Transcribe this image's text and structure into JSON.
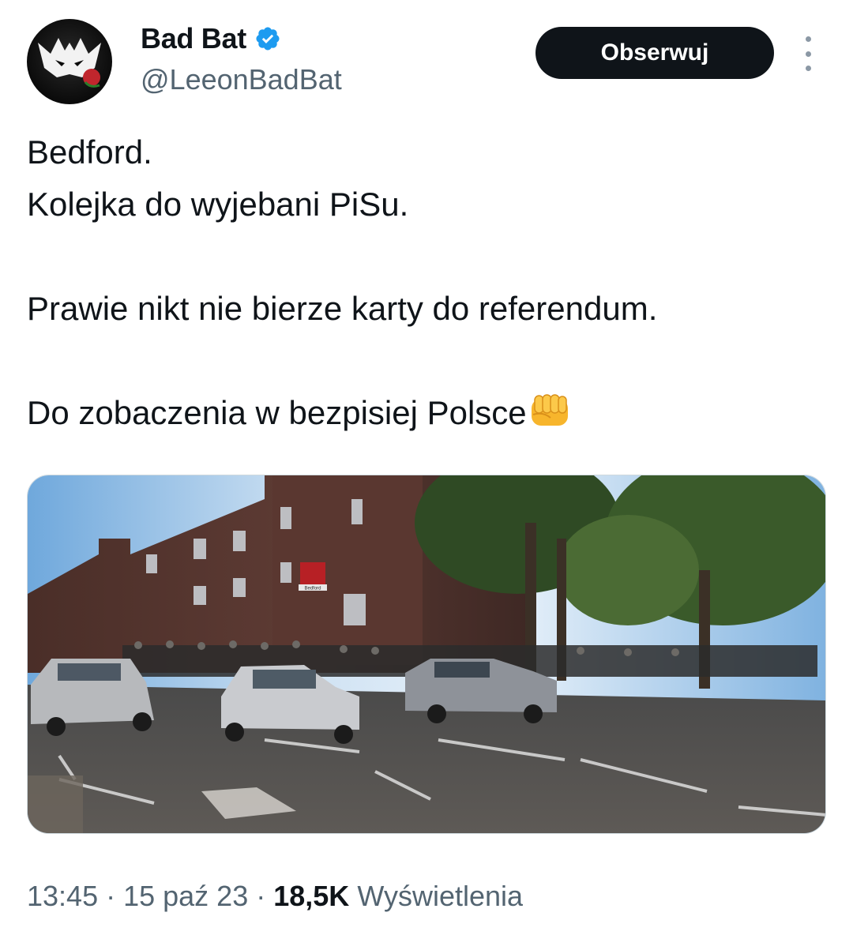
{
  "author": {
    "display_name": "Bad Bat",
    "handle": "@LeeonBadBat",
    "verified": true
  },
  "follow_button": {
    "label": "Obserwuj"
  },
  "more_menu": {
    "icon": "more-vertical-icon"
  },
  "tweet": {
    "lines": [
      "Bedford.",
      "Kolejka do wyjebani PiSu.",
      "Prawie nikt nie bierze karty do referendum.",
      "Do zobaczenia w bezpisiej Polsce"
    ],
    "emoji": "oncoming-fist-icon"
  },
  "media": {
    "station_sign": "Bedford"
  },
  "meta": {
    "time": "13:45",
    "sep1": " · ",
    "date": "15 paź 23",
    "sep2": " · ",
    "views_count": "18,5K",
    "views_label": " Wyświetlenia"
  },
  "colors": {
    "primary_text": "#0f1419",
    "secondary_text": "#536471",
    "verified_blue": "#1d9bf0",
    "button_bg": "#0f1419"
  }
}
